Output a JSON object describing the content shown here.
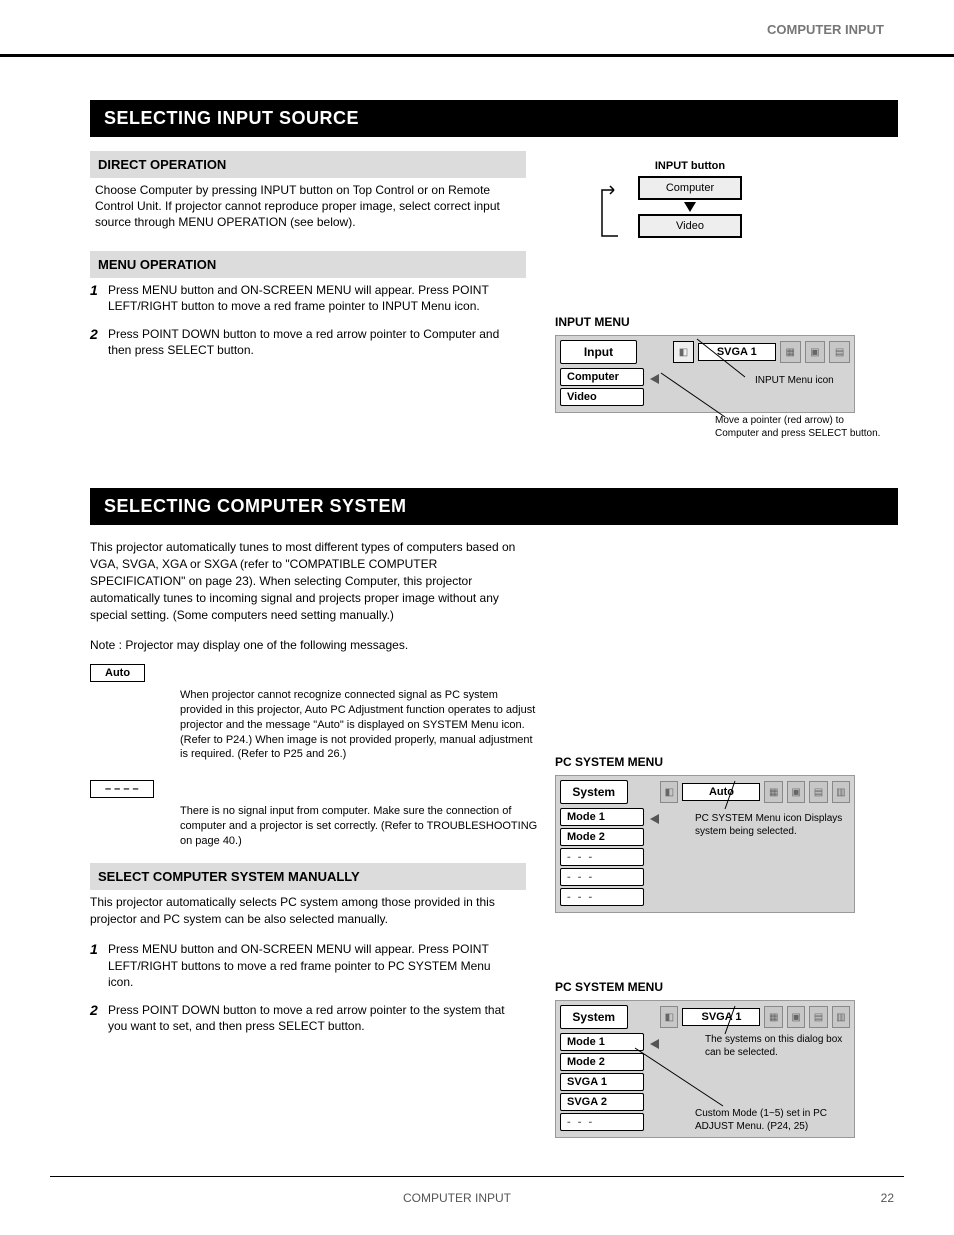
{
  "header": {
    "category": "COMPUTER INPUT"
  },
  "footer": {
    "page_num": "22",
    "title": "COMPUTER INPUT"
  },
  "section1": {
    "title": "SELECTING INPUT SOURCE",
    "direct": {
      "heading": "DIRECT OPERATION",
      "body": "Choose Computer by pressing INPUT button on Top Control or on Remote Control Unit. If projector cannot reproduce proper image, select correct input source through MENU OPERATION (see below).",
      "btn_label": "INPUT button",
      "flow_top": "Computer",
      "flow_bottom": "Video"
    },
    "menu": {
      "heading": "MENU OPERATION",
      "step1_num": "1",
      "step1": "Press MENU button and ON-SCREEN MENU will appear. Press POINT LEFT/RIGHT button to move a red frame pointer to INPUT Menu icon.",
      "step2_num": "2",
      "step2": "Press POINT DOWN button to move a red arrow pointer to Computer and then press SELECT button.",
      "panel": {
        "title": "Input",
        "svga": "SVGA 1",
        "icons": [
          "⚙",
          "▦",
          "▣",
          "▤"
        ],
        "items": [
          "Computer",
          "Video"
        ],
        "callout_icon": "INPUT Menu icon",
        "callout_ptr": "Move a pointer (red arrow) to Computer and press SELECT button."
      },
      "panel_label": "INPUT MENU"
    }
  },
  "section2": {
    "title": "SELECTING COMPUTER SYSTEM",
    "intro": "This projector automatically tunes to most different types of computers based on VGA, SVGA, XGA or SXGA (refer to \"COMPATIBLE COMPUTER SPECIFICATION\" on page 23). When selecting Computer, this projector automatically tunes to incoming signal and projects proper image without any special setting. (Some computers need setting manually.)",
    "note_intro": "Note : Projector may display one of the following messages.",
    "auto": {
      "label": "Auto",
      "body": "When projector cannot recognize connected signal as PC system provided in this projector, Auto PC Adjustment function operates to adjust projector and the message \"Auto\" is displayed on SYSTEM Menu icon. (Refer to P24.) When image is not provided properly, manual adjustment is required. (Refer to P25 and 26.)"
    },
    "nosig": {
      "label": "– – – –",
      "body": "There is no signal input from computer. Make sure the connection of computer and a projector is set correctly. (Refer to TROUBLESHOOTING on page 40.)"
    },
    "panel1": {
      "heading": "PC SYSTEM MENU",
      "title": "System",
      "svga": "Auto",
      "items": [
        "Mode 1",
        "Mode 2",
        "- - -",
        "- - -",
        "- - -"
      ],
      "callout": "PC SYSTEM Menu icon Displays system being selected."
    },
    "manual": {
      "heading": "SELECT COMPUTER SYSTEM MANUALLY",
      "intro": "This projector automatically selects PC system among those provided in this projector and PC system can be also selected manually.",
      "step1_num": "1",
      "step1": "Press MENU button and ON-SCREEN MENU will appear. Press POINT LEFT/RIGHT buttons to move a red frame pointer to PC SYSTEM Menu icon.",
      "step2_num": "2",
      "step2": "Press POINT DOWN button to move a red arrow pointer to the system that you want to set, and then press SELECT button."
    },
    "panel2": {
      "heading": "PC SYSTEM MENU",
      "title": "System",
      "svga": "SVGA 1",
      "items": [
        "Mode 1",
        "Mode 2",
        "SVGA 1",
        "SVGA 2",
        "- - -"
      ],
      "callout_top": "The systems on this dialog box can be selected.",
      "callout_bottom": "Custom Mode (1~5) set in PC ADJUST Menu. (P24, 25)"
    }
  }
}
